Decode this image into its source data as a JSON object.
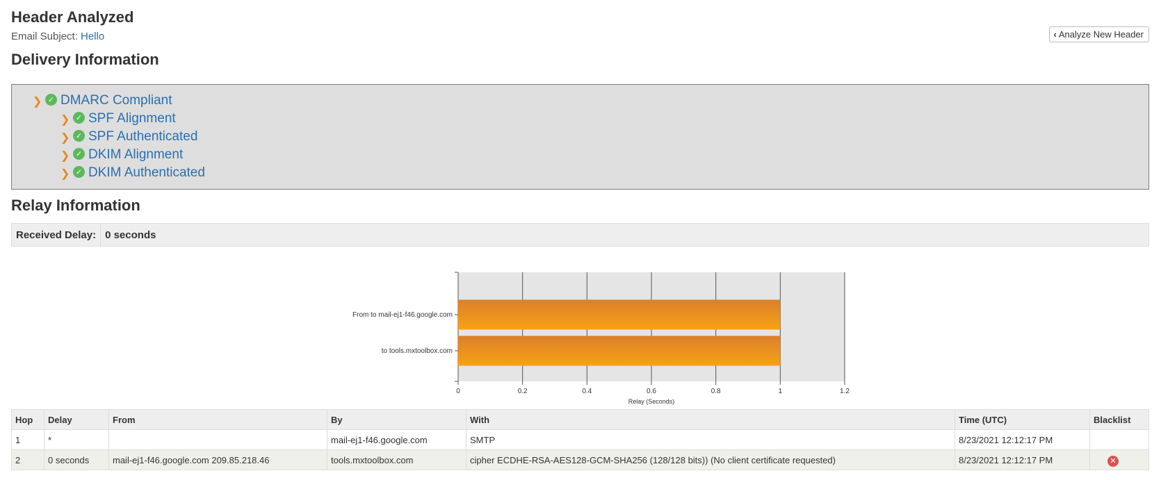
{
  "header": {
    "title": "Header Analyzed",
    "subject_label": "Email Subject:",
    "subject_value": "Hello",
    "analyze_button": "Analyze New Header"
  },
  "delivery": {
    "title": "Delivery Information",
    "root": {
      "label": "DMARC Compliant",
      "status": "pass"
    },
    "children": [
      {
        "label": "SPF Alignment",
        "status": "pass"
      },
      {
        "label": "SPF Authenticated",
        "status": "pass"
      },
      {
        "label": "DKIM Alignment",
        "status": "pass"
      },
      {
        "label": "DKIM Authenticated",
        "status": "pass"
      }
    ]
  },
  "relay": {
    "title": "Relay Information",
    "received_delay_label": "Received Delay:",
    "received_delay_value": "0 seconds"
  },
  "chart_data": {
    "type": "bar",
    "orientation": "horizontal",
    "categories": [
      "From  to mail-ej1-f46.google.com",
      "to tools.mxtoolbox.com"
    ],
    "values": [
      1,
      1
    ],
    "xlabel": "Relay (Seconds)",
    "xlim": [
      0,
      1.2
    ],
    "xticks": [
      "0",
      "0.2",
      "0.4",
      "0.6",
      "0.8",
      "1",
      "1.2"
    ],
    "grid": true,
    "colors": {
      "bar_top": "#dc7f2c",
      "bar_bottom": "#f7a213",
      "plot_bg": "#e5e5e5"
    }
  },
  "table": {
    "columns": [
      "Hop",
      "Delay",
      "From",
      "By",
      "With",
      "Time (UTC)",
      "Blacklist"
    ],
    "rows": [
      [
        "1",
        "*",
        "",
        "mail-ej1-f46.google.com",
        "SMTP",
        "8/23/2021 12:12:17 PM",
        ""
      ],
      [
        "2",
        "0 seconds",
        "mail-ej1-f46.google.com 209.85.218.46",
        "tools.mxtoolbox.com",
        "cipher ECDHE-RSA-AES128-GCM-SHA256 (128/128 bits)) (No client certificate requested)",
        "8/23/2021 12:12:17 PM",
        ""
      ]
    ],
    "blacklist_icons": [
      "",
      "close-circle-icon"
    ]
  },
  "icons": {
    "arrow": "chevron-right-icon",
    "check": "check-circle-icon",
    "back": "chevron-left-icon"
  },
  "colors": {
    "link": "#2a6fb0",
    "check": "#5cb85c",
    "arrow": "#e8881b",
    "error": "#d9534f"
  }
}
